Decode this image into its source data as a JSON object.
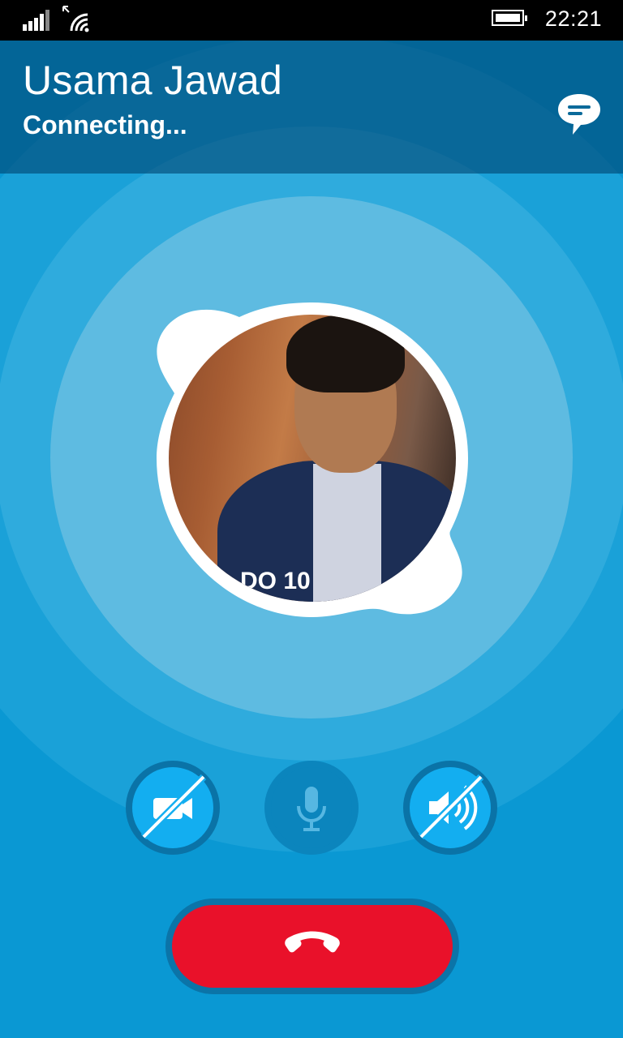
{
  "status_bar": {
    "time": "22:21",
    "signal_icon": "signal-bars-icon",
    "wifi_icon": "wifi-icon",
    "battery_icon": "battery-icon"
  },
  "call": {
    "contact_name": "Usama Jawad",
    "status": "Connecting...",
    "chat_icon": "chat-bubble-icon",
    "avatar_caption": "DO  10"
  },
  "controls": {
    "video": {
      "icon": "video-off-icon",
      "state": "off"
    },
    "mic": {
      "icon": "microphone-icon",
      "state": "disabled"
    },
    "speaker": {
      "icon": "speaker-off-icon",
      "state": "off"
    },
    "end_call": {
      "icon": "hang-up-icon"
    }
  },
  "colors": {
    "background": "#0a98d3",
    "end_call": "#e9112a",
    "control_active": "#13aef0",
    "header_overlay": "#004673"
  }
}
